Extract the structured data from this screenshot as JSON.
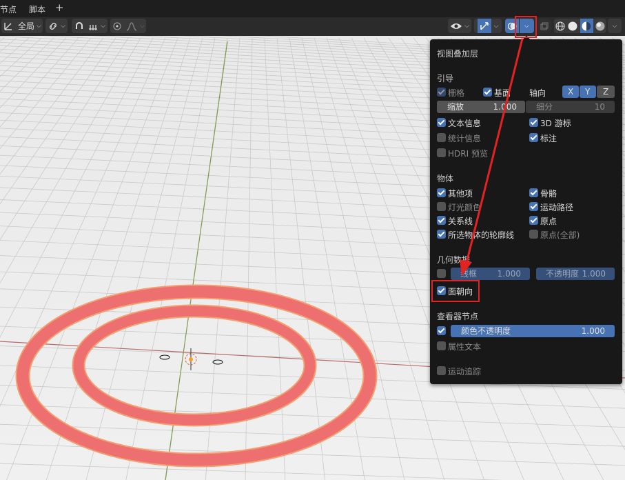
{
  "tabs": {
    "nodes": "节点",
    "script": "脚本",
    "add": "+"
  },
  "toolbar": {
    "orientation": "全局",
    "icons": [
      "transform-icon",
      "link-icon",
      "snap-magnet-icon",
      "snap-grid-icon",
      "proportional-edit-icon",
      "falloff-curve-icon",
      "visibility-eye-icon",
      "gizmo-icon",
      "overlay-icon",
      "xray-icon",
      "wireframe-shading-icon",
      "solid-shading-icon",
      "material-shading-icon",
      "rendered-shading-icon"
    ]
  },
  "overlay_panel": {
    "title": "视图叠加层",
    "guides": {
      "heading": "引导",
      "grid": {
        "label": "栅格",
        "checked": true
      },
      "floor": {
        "label": "基面",
        "checked": true
      },
      "axes_label": "轴向",
      "axes": [
        "X",
        "Y",
        "Z"
      ],
      "scale": {
        "label": "缩放",
        "value": "1.000"
      },
      "subdivisions": {
        "label": "细分",
        "value": "10"
      },
      "text_info": {
        "label": "文本信息",
        "checked": true
      },
      "cursor_3d": {
        "label": "3D 游标",
        "checked": true
      },
      "statistics": {
        "label": "统计信息",
        "checked": false
      },
      "annotations": {
        "label": "标注",
        "checked": true
      },
      "hdri_preview": {
        "label": "HDRI 预览",
        "checked": false
      }
    },
    "objects": {
      "heading": "物体",
      "extras": {
        "label": "其他项",
        "checked": true
      },
      "bones": {
        "label": "骨骼",
        "checked": true
      },
      "light_colors": {
        "label": "灯光颜色",
        "checked": false
      },
      "motion_paths": {
        "label": "运动路径",
        "checked": true
      },
      "relationship_lines": {
        "label": "关系线",
        "checked": true
      },
      "origins": {
        "label": "原点",
        "checked": true
      },
      "outline_selected": {
        "label": "所选物体的轮廓线",
        "checked": true
      },
      "origins_all": {
        "label": "原点(全部)",
        "checked": false
      }
    },
    "geometry": {
      "heading": "几何数据",
      "wireframe": {
        "label": "线框",
        "value": "1.000",
        "checked": false
      },
      "opacity": {
        "label": "不透明度",
        "value": "1.000"
      },
      "face_orientation": {
        "label": "面朝向",
        "checked": true
      }
    },
    "viewer_node": {
      "heading": "查看器节点",
      "color_opacity": {
        "label": "颜色不透明度",
        "value": "1.000",
        "checked": true
      },
      "attribute_text": {
        "label": "属性文本",
        "checked": false
      }
    },
    "motion_tracking": {
      "label": "运动追踪",
      "checked": false
    }
  },
  "colors": {
    "accent": "#4772b3",
    "annotation": "#e32222",
    "rings": "#ee6f70"
  }
}
